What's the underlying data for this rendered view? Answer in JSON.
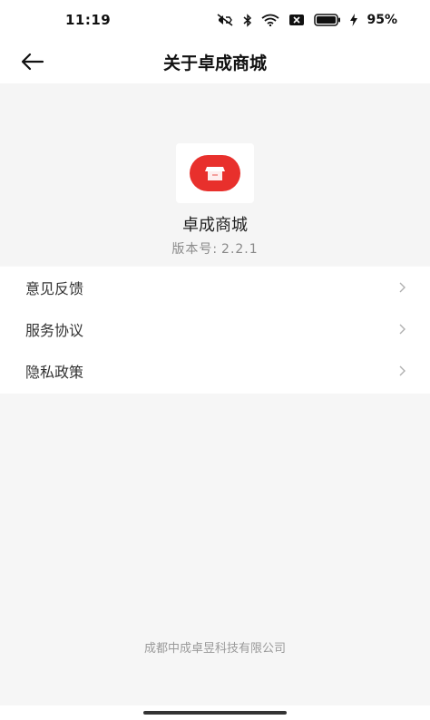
{
  "status_bar": {
    "time": "11:19",
    "battery": "95%",
    "icons": [
      "mute-icon",
      "bluetooth-icon",
      "wifi-icon",
      "sim-icon",
      "battery-icon",
      "charging-icon"
    ]
  },
  "nav": {
    "title": "关于卓成商城",
    "back_icon": "arrow-left-icon"
  },
  "app": {
    "name": "卓成商城",
    "version_label": "版本号:",
    "version": "2.2.1",
    "logo_icon": "store-icon",
    "brand_color": "#e8302c"
  },
  "menu": {
    "items": [
      {
        "label": "意见反馈",
        "icon": "chevron-right-icon"
      },
      {
        "label": "服务协议",
        "icon": "chevron-right-icon"
      },
      {
        "label": "隐私政策",
        "icon": "chevron-right-icon"
      }
    ]
  },
  "footer": {
    "company": "成都中成卓昱科技有限公司"
  }
}
